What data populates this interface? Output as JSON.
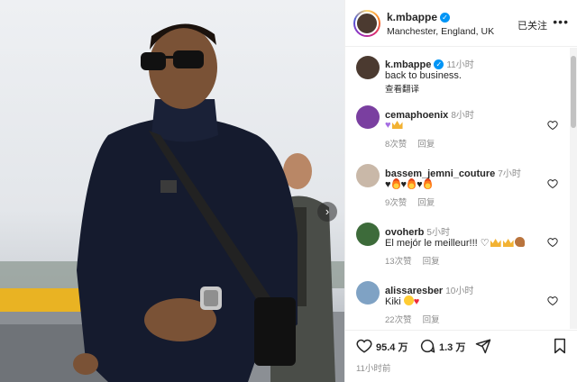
{
  "post": {
    "username": "k.mbappe",
    "location": "Manchester, England, UK",
    "follow_label": "已关注",
    "more_label": "•••",
    "caption": {
      "username": "k.mbappe",
      "time": "11小时",
      "text": "back to business.",
      "translate_label": "查看翻译"
    }
  },
  "comments": [
    {
      "username": "cemaphoenix",
      "time": "8小时",
      "likes": "8次赞",
      "reply": "回复"
    },
    {
      "username": "bassem_jemni_couture",
      "time": "7小时",
      "likes": "9次赞",
      "reply": "回复"
    },
    {
      "username": "ovoherb",
      "time": "5小时",
      "text": "El mejór le meilleur!!!",
      "likes": "13次赞",
      "reply": "回复"
    },
    {
      "username": "alissaresber",
      "time": "10小时",
      "text": "Kiki",
      "likes": "22次赞",
      "reply": "回复"
    }
  ],
  "actions": {
    "like_count": "95.4 万",
    "comment_count": "1.3 万",
    "posted_time": "11小时前"
  },
  "colors": {
    "accent": "#0095f6",
    "text": "#262626",
    "muted": "#8e8e8e",
    "border": "#efefef"
  },
  "icons": [
    "verified-badge-icon",
    "heart-icon",
    "comment-icon",
    "share-icon",
    "bookmark-icon",
    "chevron-right-icon"
  ]
}
